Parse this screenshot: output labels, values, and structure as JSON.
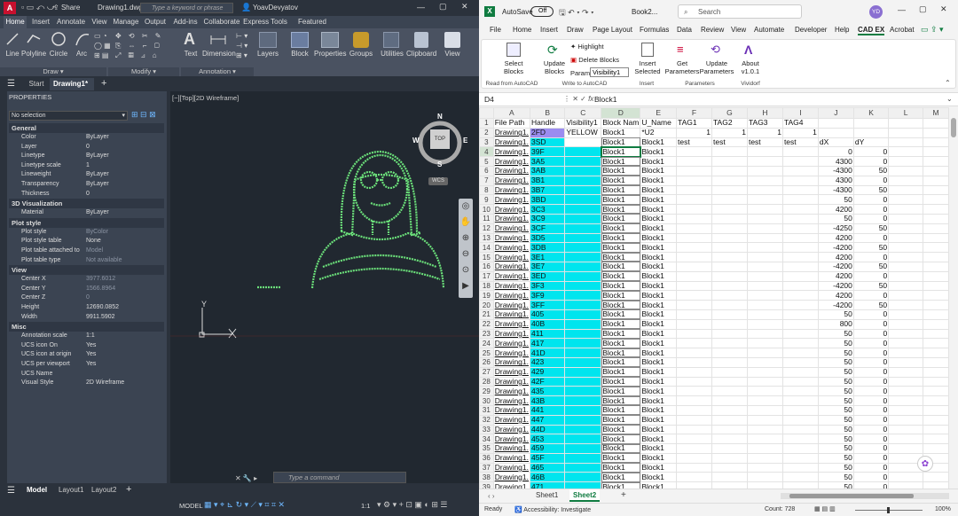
{
  "acad": {
    "title": {
      "file": "Drawing1.dwg",
      "search_placeholder": "Type a keyword or phrase",
      "user": "YoavDevyatov",
      "share": "Share"
    },
    "tabs": [
      "Home",
      "Insert",
      "Annotate",
      "View",
      "Manage",
      "Output",
      "Add-ins",
      "Collaborate",
      "Express Tools",
      "Featured Apps"
    ],
    "ribbon": {
      "line": "Line",
      "polyline": "Polyline",
      "circle": "Circle",
      "arc": "Arc",
      "text": "Text",
      "dimension": "Dimension",
      "layers": "Layers",
      "block": "Block",
      "properties": "Properties",
      "groups": "Groups",
      "utilities": "Utilities",
      "clipboard": "Clipboard",
      "view": "View",
      "draw_group": "Draw",
      "modify_group": "Modify",
      "annotation_group": "Annotation"
    },
    "filetabs": {
      "start": "Start",
      "drawing": "Drawing1*"
    },
    "viewport_label": "[−][Top][2D Wireframe]",
    "viewcube": {
      "n": "N",
      "s": "S",
      "e": "E",
      "w": "W",
      "top": "TOP",
      "wcs": "WCS"
    },
    "ucs": {
      "y": "Y"
    },
    "props": {
      "title": "PROPERTIES",
      "selection": "No selection",
      "sections": [
        {
          "name": "General",
          "rows": [
            [
              "Color",
              "ByLayer"
            ],
            [
              "Layer",
              "0"
            ],
            [
              "Linetype",
              "ByLayer"
            ],
            [
              "Linetype scale",
              "1"
            ],
            [
              "Lineweight",
              "ByLayer"
            ],
            [
              "Transparency",
              "ByLayer"
            ],
            [
              "Thickness",
              "0"
            ]
          ]
        },
        {
          "name": "3D Visualization",
          "rows": [
            [
              "Material",
              "ByLayer"
            ]
          ]
        },
        {
          "name": "Plot style",
          "rows": [
            [
              "Plot style",
              "ByColor"
            ],
            [
              "Plot style table",
              "None"
            ],
            [
              "Plot table attached to",
              "Model"
            ],
            [
              "Plot table type",
              "Not available"
            ]
          ]
        },
        {
          "name": "View",
          "rows": [
            [
              "Center X",
              "3977.6012"
            ],
            [
              "Center Y",
              "1566.8964"
            ],
            [
              "Center Z",
              "0"
            ],
            [
              "Height",
              "12690.0852"
            ],
            [
              "Width",
              "9911.5902"
            ]
          ]
        },
        {
          "name": "Misc",
          "rows": [
            [
              "Annotation scale",
              "1:1"
            ],
            [
              "UCS icon On",
              "Yes"
            ],
            [
              "UCS icon at origin",
              "Yes"
            ],
            [
              "UCS per viewport",
              "Yes"
            ],
            [
              "UCS Name",
              ""
            ],
            [
              "Visual Style",
              "2D Wireframe"
            ]
          ]
        }
      ]
    },
    "command_placeholder": "Type a command",
    "layouts": {
      "model": "Model",
      "l1": "Layout1",
      "l2": "Layout2"
    },
    "status": {
      "model": "MODEL",
      "scale": "1:1"
    }
  },
  "excel": {
    "autosave": "AutoSave",
    "autosave_state": "Off",
    "book": "Book2...",
    "search_placeholder": "Search",
    "user_initials": "YD",
    "menu": [
      "File",
      "Home",
      "Insert",
      "Draw",
      "Page Layout",
      "Formulas",
      "Data",
      "Review",
      "View",
      "Automate",
      "Developer",
      "Help",
      "CAD EX",
      "Acrobat"
    ],
    "ribbon": {
      "select_blocks": "Select Blocks",
      "update_blocks": "Update Blocks",
      "highlight": "Highlight",
      "delete_blocks": "Delete Blocks",
      "param_label": "Param:",
      "param_value": "Visibility1",
      "insert_selected": "Insert Selected",
      "get_params": "Get Parameters",
      "update_params": "Update Parameters",
      "about": "About v1.0.1",
      "g1": "Read from AutoCAD",
      "g2": "Write to AutoCAD",
      "g3": "Insert",
      "g4": "Parameters",
      "g5": "Vividorf"
    },
    "namebox": "D4",
    "formula": "Block1",
    "cols": [
      "A",
      "B",
      "C",
      "D",
      "E",
      "F",
      "G",
      "H",
      "I",
      "J",
      "K",
      "L",
      "M"
    ],
    "row1": [
      "File Path",
      "Handle",
      "Visibility1",
      "Block Nam",
      "U_Name",
      "TAG1",
      "TAG2",
      "TAG3",
      "TAG4",
      "",
      "",
      "",
      ""
    ],
    "row2": [
      "Drawing1.",
      "2FD",
      "YELLOW",
      "Block1",
      "*U2",
      "1",
      "1",
      "1",
      "1",
      "",
      "",
      "",
      ""
    ],
    "row3": [
      "Drawing1.",
      "3SD",
      "",
      "Block1",
      "Block1",
      "test",
      "test",
      "test",
      "test",
      "dX",
      "dY",
      "",
      ""
    ],
    "link_text": "Drawing1.",
    "block_text": "Block1",
    "handles": [
      "39F",
      "3A5",
      "3AB",
      "3B1",
      "3B7",
      "3BD",
      "3C3",
      "3C9",
      "3CF",
      "3D5",
      "3DB",
      "3E1",
      "3E7",
      "3ED",
      "3F3",
      "3F9",
      "3FF",
      "405",
      "40B",
      "411",
      "417",
      "41D",
      "423",
      "429",
      "42F",
      "435",
      "43B",
      "441",
      "447",
      "44D",
      "453",
      "459",
      "45F",
      "465",
      "46B",
      "471"
    ],
    "dx": [
      "0",
      "4300",
      "-4300",
      "4300",
      "-4300",
      "50",
      "4200",
      "50",
      "-4250",
      "4200",
      "-4200",
      "4200",
      "-4200",
      "4200",
      "-4200",
      "4200",
      "-4200",
      "50",
      "800",
      "50",
      "50",
      "50",
      "50",
      "50",
      "50",
      "50",
      "50",
      "50",
      "50",
      "50",
      "50",
      "50",
      "50",
      "50",
      "50",
      "50"
    ],
    "dy": [
      "0",
      "0",
      "50",
      "0",
      "50",
      "0",
      "0",
      "0",
      "50",
      "0",
      "50",
      "0",
      "50",
      "0",
      "50",
      "0",
      "50",
      "0",
      "0",
      "0",
      "0",
      "0",
      "0",
      "0",
      "0",
      "0",
      "0",
      "0",
      "0",
      "0",
      "0",
      "0",
      "0",
      "0",
      "0",
      "0"
    ],
    "sheets": [
      "Sheet1",
      "Sheet2"
    ],
    "status": {
      "ready": "Ready",
      "accessibility": "Accessibility: Investigate",
      "count": "Count: 728",
      "zoom": "100%"
    }
  }
}
